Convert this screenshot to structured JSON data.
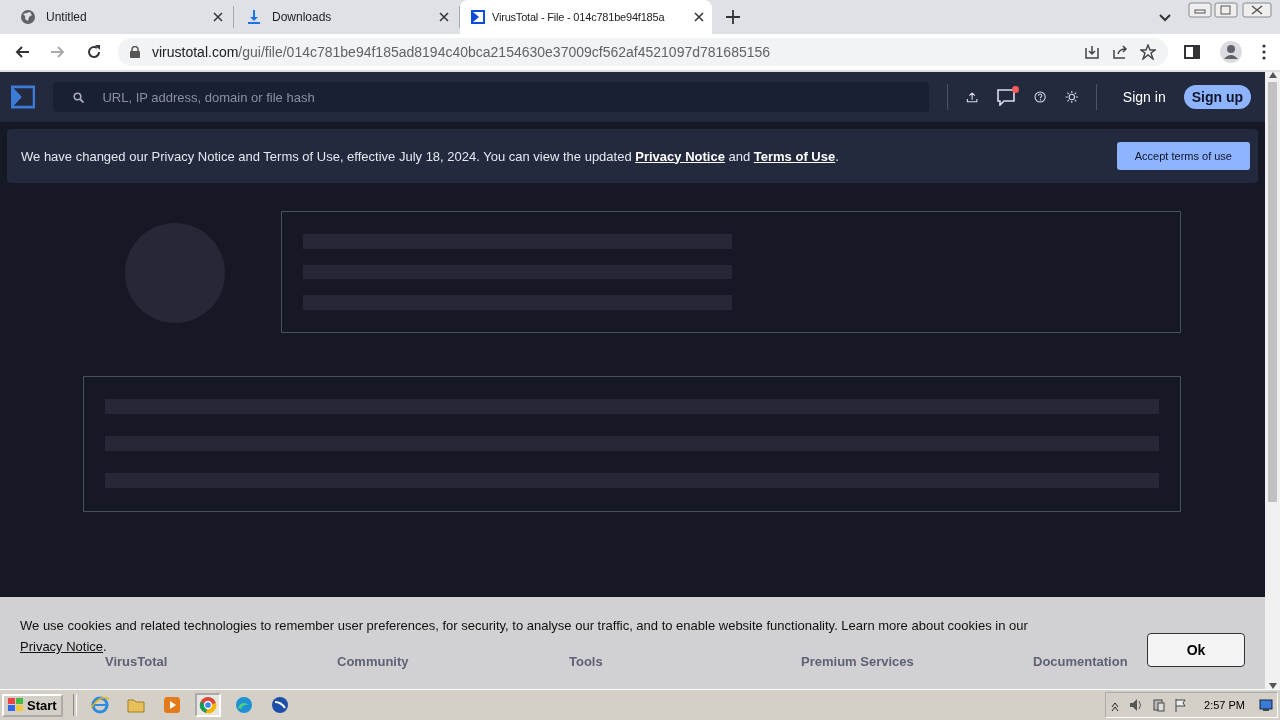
{
  "browser": {
    "tabs": [
      {
        "title": "Untitled",
        "kind": "globe",
        "selected": false
      },
      {
        "title": "Downloads",
        "kind": "download",
        "selected": false
      },
      {
        "title": "VirusTotal - File - 014c781be94f185a",
        "kind": "sigma",
        "selected": true
      }
    ],
    "url_host": "virustotal.com",
    "url_path": "/gui/file/014c781be94f185ad8194c40bca2154630e37009cf562af4521097d781685156"
  },
  "header": {
    "search_placeholder": "URL, IP address, domain or file hash",
    "has_notification": true,
    "sign_in": "Sign in",
    "sign_up": "Sign up"
  },
  "notice": {
    "before": "We have changed our Privacy Notice and Terms of Use, effective July 18, 2024. You can view the updated ",
    "link_1": "Privacy Notice",
    "middle": " and ",
    "link_2": "Terms of Use",
    "after": ".",
    "button": "Accept terms of use"
  },
  "footer": {
    "headings": [
      "VirusTotal",
      "Community",
      "Tools",
      "Premium Services",
      "Documentation"
    ]
  },
  "cookie_banner": {
    "text": "We use cookies and related technologies to remember user preferences, for security, to analyse our traffic, and to enable website functionality. Learn more about cookies in our ",
    "link": "Privacy Notice",
    "after": ".",
    "button": "Ok"
  },
  "taskbar": {
    "start": "Start",
    "apps": [
      {
        "kind": "ie",
        "selected": false
      },
      {
        "kind": "folder",
        "selected": false
      },
      {
        "kind": "media",
        "selected": false
      },
      {
        "kind": "chrome",
        "selected": true
      },
      {
        "kind": "edge",
        "selected": false
      },
      {
        "kind": "app",
        "selected": false
      }
    ],
    "clock": "2:57 PM"
  }
}
